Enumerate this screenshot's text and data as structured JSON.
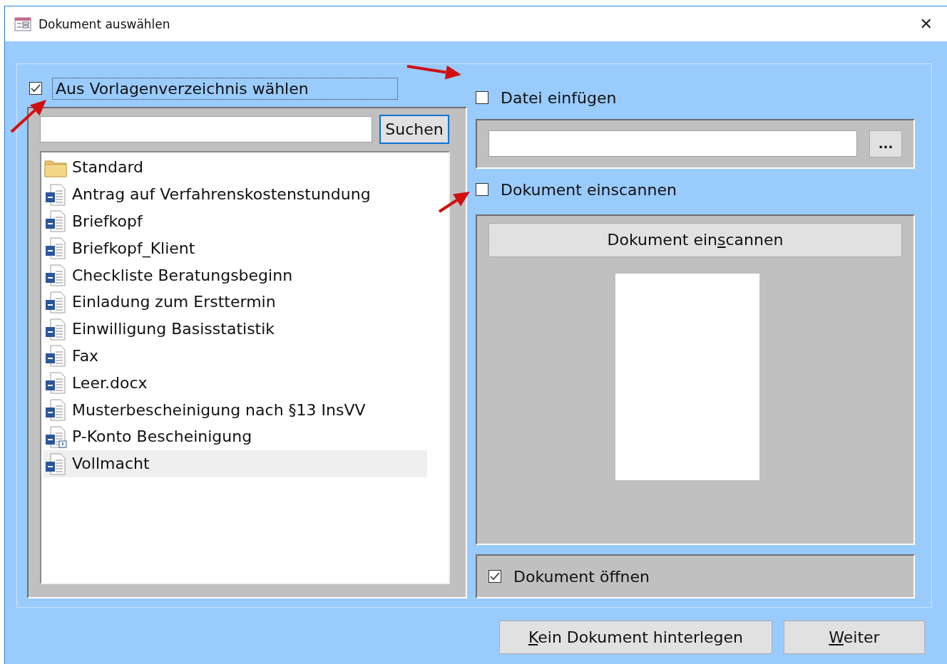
{
  "window": {
    "title": "Dokument auswählen",
    "close": "✕"
  },
  "template_option": {
    "label": "Aus Vorlagenverzeichnis wählen",
    "checked": true,
    "focused": true
  },
  "search": {
    "button": "Suchen"
  },
  "templates": [
    {
      "label": "Standard",
      "kind": "folder",
      "selected": false
    },
    {
      "label": "Antrag auf Verfahrenskostenstundung",
      "kind": "document",
      "selected": false
    },
    {
      "label": "Briefkopf",
      "kind": "document",
      "selected": false
    },
    {
      "label": "Briefkopf_Klient",
      "kind": "document",
      "selected": false
    },
    {
      "label": "Checkliste Beratungsbeginn",
      "kind": "document",
      "selected": false
    },
    {
      "label": "Einladung zum Ersttermin",
      "kind": "document",
      "selected": false
    },
    {
      "label": "Einwilligung Basisstatistik",
      "kind": "document",
      "selected": false
    },
    {
      "label": "Fax",
      "kind": "document",
      "selected": false
    },
    {
      "label": "Leer.docx",
      "kind": "document",
      "selected": false
    },
    {
      "label": "Musterbescheinigung nach §13 InsVV",
      "kind": "document",
      "selected": false
    },
    {
      "label": "P-Konto Bescheinigung",
      "kind": "document-flagged",
      "selected": false
    },
    {
      "label": "Vollmacht",
      "kind": "document",
      "selected": true
    }
  ],
  "file_option": {
    "label": "Datei einfügen",
    "checked": false
  },
  "file_path": {
    "browse_button": "..."
  },
  "scan_option": {
    "label": "Dokument einscannen",
    "checked": false
  },
  "scan_button": {
    "before": "Dokument ein",
    "access_key": "s",
    "after": "cannen"
  },
  "open_option": {
    "label": "Dokument öffnen",
    "checked": true
  },
  "buttons": [
    {
      "access_key": "K",
      "after": "ein Dokument hinterlegen"
    },
    {
      "access_key": "W",
      "after": "eiter"
    }
  ]
}
